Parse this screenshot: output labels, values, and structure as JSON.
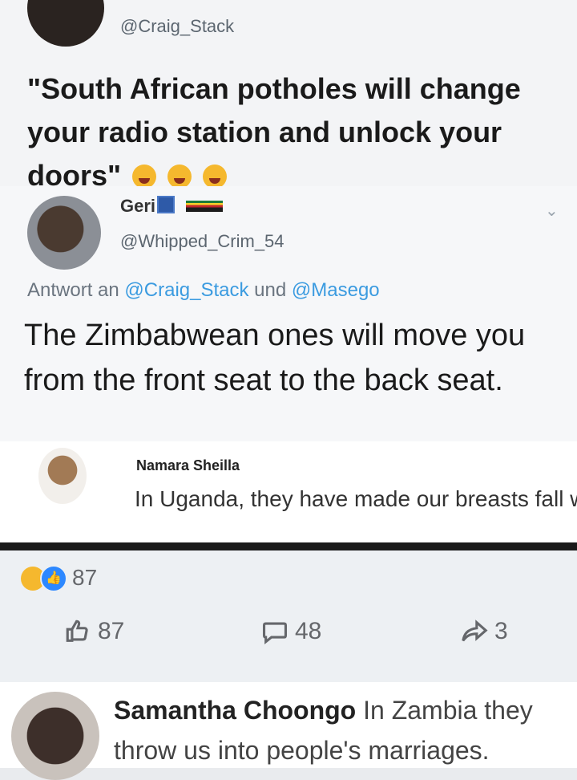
{
  "tweet": {
    "name_partial": "Craig Stack",
    "handle": "@Craig_Stack",
    "text": "\"South African potholes will change your radio station and unlock your doors\""
  },
  "reply": {
    "name": "Geri",
    "handle": "@Whipped_Crim_54",
    "reply_prefix": "Antwort an ",
    "mention1": "@Craig_Stack",
    "reply_joiner": " und ",
    "mention2": "@Masego",
    "text": "The Zimbabwean ones will move you from the front seat to the back seat."
  },
  "comment_namara": {
    "author": "Namara Sheilla",
    "text": "In Uganda, they have made our breasts fall while we are still young"
  },
  "reactions": {
    "count": "87"
  },
  "actions": {
    "like_count": "87",
    "comment_count": "48",
    "share_count": "3"
  },
  "comment_samantha": {
    "author": "Samantha Choongo",
    "text": " In Zambia they throw us into people's marriages."
  },
  "icons": {
    "like": "thumbs-up-icon",
    "comment": "speech-bubble-icon",
    "share": "share-arrow-icon"
  }
}
